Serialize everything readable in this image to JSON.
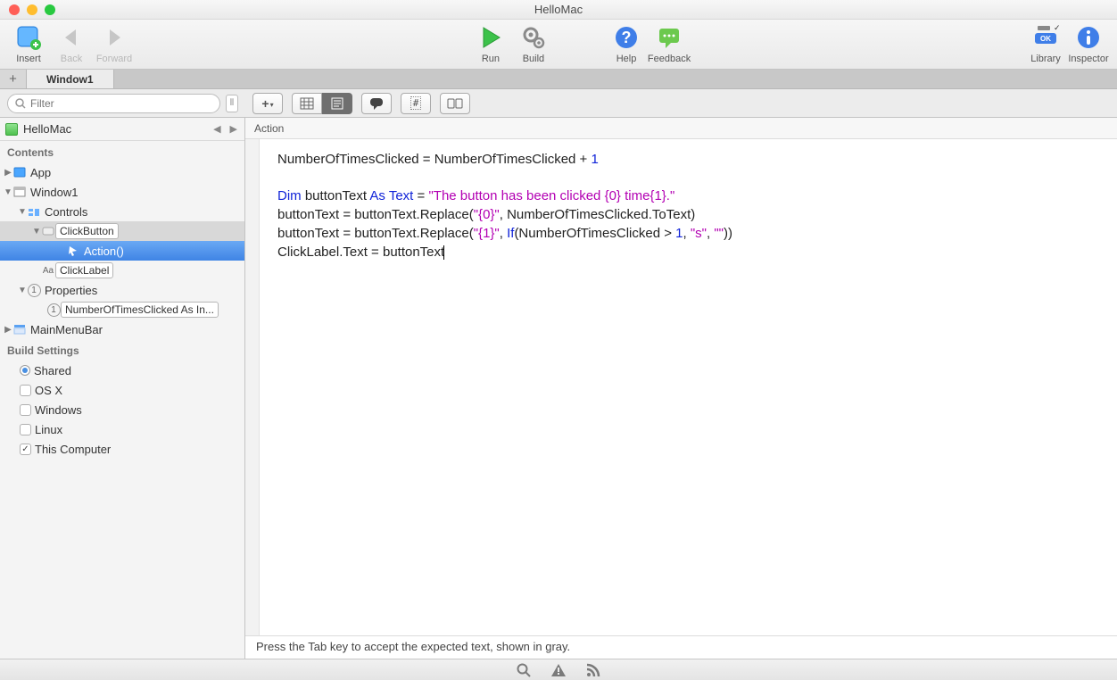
{
  "window": {
    "title": "HelloMac"
  },
  "toolbar": {
    "insert": "Insert",
    "back": "Back",
    "forward": "Forward",
    "run": "Run",
    "build": "Build",
    "help": "Help",
    "feedback": "Feedback",
    "library": "Library",
    "inspector": "Inspector"
  },
  "tabs": {
    "active": "Window1"
  },
  "filter": {
    "placeholder": "Filter"
  },
  "project": {
    "name": "HelloMac"
  },
  "sections": {
    "contents": "Contents",
    "build": "Build Settings"
  },
  "tree": {
    "app": "App",
    "window1": "Window1",
    "controls": "Controls",
    "clickbutton": "ClickButton",
    "action": "Action()",
    "clicklabel": "ClickLabel",
    "aa": "Aa",
    "properties": "Properties",
    "prop1": "NumberOfTimesClicked As In...",
    "mainmenubar": "MainMenuBar",
    "shared": "Shared",
    "osx": "OS X",
    "windows": "Windows",
    "linux": "Linux",
    "thiscomp": "This Computer"
  },
  "breadcrumb": {
    "label": "Action"
  },
  "code": {
    "l1a": "NumberOfTimesClicked = NumberOfTimesClicked + ",
    "l1n": "1",
    "l3_dim": "Dim",
    "l3_mid": " buttonText ",
    "l3_as": "As",
    "l3_sp": " ",
    "l3_text": "Text",
    "l3_eq": " = ",
    "l3_str": "\"The button has been clicked {0} time{1}.\"",
    "l4a": "buttonText = buttonText.Replace(",
    "l4s": "\"{0}\"",
    "l4b": ", NumberOfTimesClicked.ToText)",
    "l5a": "buttonText = buttonText.Replace(",
    "l5s": "\"{1}\"",
    "l5b": ", ",
    "l5if": "If",
    "l5c": "(NumberOfTimesClicked > ",
    "l5n": "1",
    "l5d": ", ",
    "l5s2": "\"s\"",
    "l5e": ", ",
    "l5s3": "\"\"",
    "l5f": "))",
    "l6": "ClickLabel.Text = buttonText"
  },
  "hint": "Press the Tab key to accept the expected text, shown in gray.",
  "icons": {
    "search": "search-icon",
    "warn": "warning-icon",
    "rss": "rss-icon"
  }
}
